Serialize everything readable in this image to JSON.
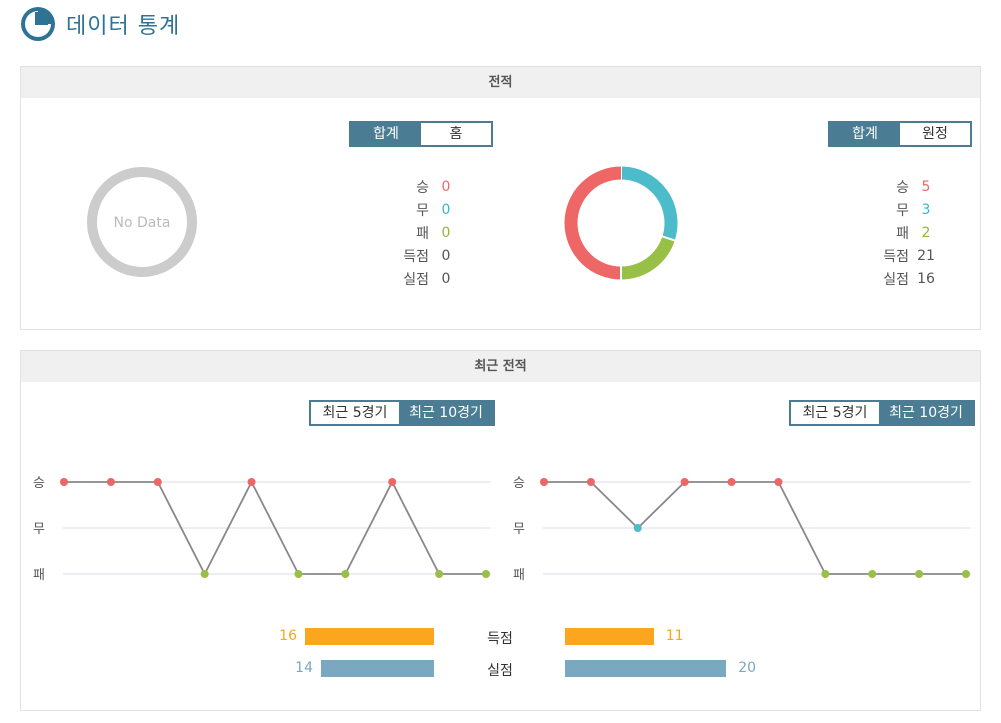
{
  "header": {
    "title": "데이터 통계",
    "icon": "pie-chart-icon"
  },
  "head_to_head": {
    "section_title": "전적",
    "left": {
      "toggle": {
        "total": "합계",
        "venue": "홈",
        "active": "total"
      },
      "no_data_text": "No Data",
      "stats": [
        {
          "label": "승",
          "value": "0",
          "color": "#e96a6a"
        },
        {
          "label": "무",
          "value": "0",
          "color": "#3ab6c9"
        },
        {
          "label": "패",
          "value": "0",
          "color": "#8fb83a"
        },
        {
          "label": "득점",
          "value": "0",
          "color": "#555555"
        },
        {
          "label": "실점",
          "value": "0",
          "color": "#555555"
        }
      ]
    },
    "right": {
      "toggle": {
        "total": "합계",
        "venue": "원정",
        "active": "total"
      },
      "stats": [
        {
          "label": "승",
          "value": "5",
          "color": "#e96a6a"
        },
        {
          "label": "무",
          "value": "3",
          "color": "#3ab6c9"
        },
        {
          "label": "패",
          "value": "2",
          "color": "#8fb83a"
        },
        {
          "label": "득점",
          "value": "21",
          "color": "#555555"
        },
        {
          "label": "실점",
          "value": "16",
          "color": "#555555"
        }
      ]
    },
    "donut": {
      "win": 5,
      "draw": 3,
      "loss": 2,
      "colors": {
        "win": "#ee6666",
        "draw": "#4cbccb",
        "loss": "#99c046"
      }
    }
  },
  "recent": {
    "section_title": "최근 전적",
    "left_toggle": {
      "five": "최근 5경기",
      "ten": "최근 10경기",
      "active": "ten"
    },
    "right_toggle": {
      "five": "최근 5경기",
      "ten": "최근 10경기",
      "active": "ten"
    },
    "y_labels": [
      "승",
      "무",
      "패"
    ],
    "chart_data": [
      {
        "type": "line",
        "name": "left",
        "y_categories": [
          "승",
          "무",
          "패"
        ],
        "results": [
          "승",
          "승",
          "승",
          "패",
          "승",
          "패",
          "패",
          "승",
          "패",
          "패"
        ]
      },
      {
        "type": "line",
        "name": "right",
        "y_categories": [
          "승",
          "무",
          "패"
        ],
        "results": [
          "승",
          "승",
          "무",
          "승",
          "승",
          "승",
          "패",
          "패",
          "패",
          "패"
        ]
      }
    ],
    "colors": {
      "승": "#ee6666",
      "무": "#4cbccb",
      "패": "#99c046",
      "line": "#888888",
      "grid": "#d9dde8"
    },
    "bars": {
      "scored_label": "득점",
      "conceded_label": "실점",
      "left_scored": 16,
      "left_conceded": 14,
      "right_scored": 11,
      "right_conceded": 20,
      "scored_color": "#fba61e",
      "conceded_color": "#7aa8c0"
    }
  }
}
